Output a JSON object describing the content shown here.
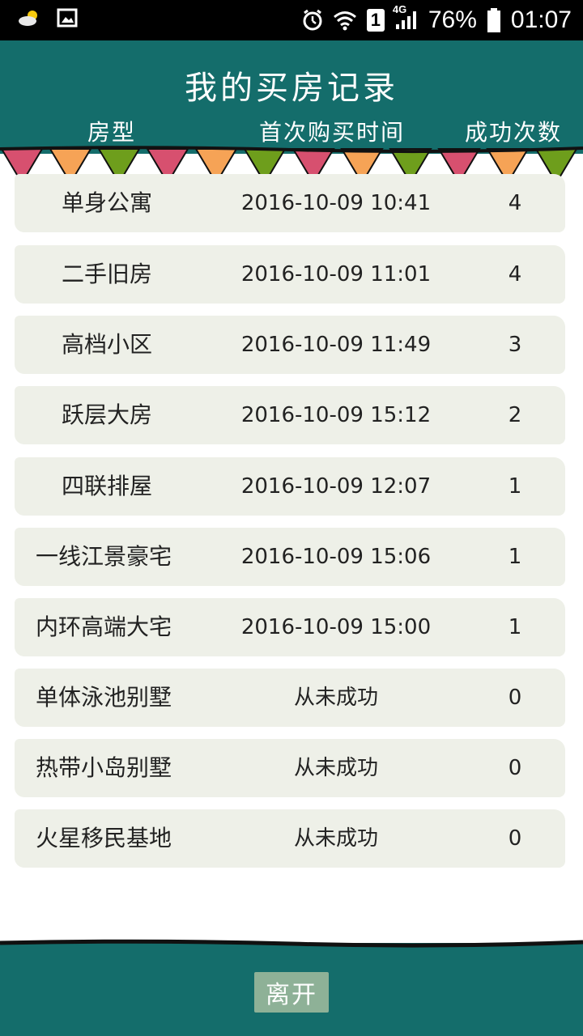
{
  "status_bar": {
    "left_icons": [
      "weather-icon",
      "image-icon"
    ],
    "sim_slot": "1",
    "network": "4G",
    "battery": "76%",
    "time": "01:07"
  },
  "header": {
    "title": "我的买房记录",
    "col_type": "房型",
    "col_time": "首次购买时间",
    "col_count": "成功次数"
  },
  "rows": [
    {
      "type": "单身公寓",
      "time": "2016-10-09 10:41",
      "count": "4"
    },
    {
      "type": "二手旧房",
      "time": "2016-10-09 11:01",
      "count": "4"
    },
    {
      "type": "高档小区",
      "time": "2016-10-09 11:49",
      "count": "3"
    },
    {
      "type": "跃层大房",
      "time": "2016-10-09 15:12",
      "count": "2"
    },
    {
      "type": "四联排屋",
      "time": "2016-10-09 12:07",
      "count": "1"
    },
    {
      "type": "一线江景豪宅",
      "time": "2016-10-09 15:06",
      "count": "1"
    },
    {
      "type": "内环高端大宅",
      "time": "2016-10-09 15:00",
      "count": "1"
    },
    {
      "type": "单体泳池别墅",
      "time": "从未成功",
      "count": "0"
    },
    {
      "type": "热带小岛别墅",
      "time": "从未成功",
      "count": "0"
    },
    {
      "type": "火星移民基地",
      "time": "从未成功",
      "count": "0"
    }
  ],
  "footer": {
    "leave_label": "离开"
  },
  "colors": {
    "header_bg": "#146d6b",
    "row_bg": "#eef0e8",
    "button_bg": "#8eb197",
    "flag_pink": "#d7506f",
    "flag_orange": "#f6a356",
    "flag_green": "#6e9e1c"
  }
}
